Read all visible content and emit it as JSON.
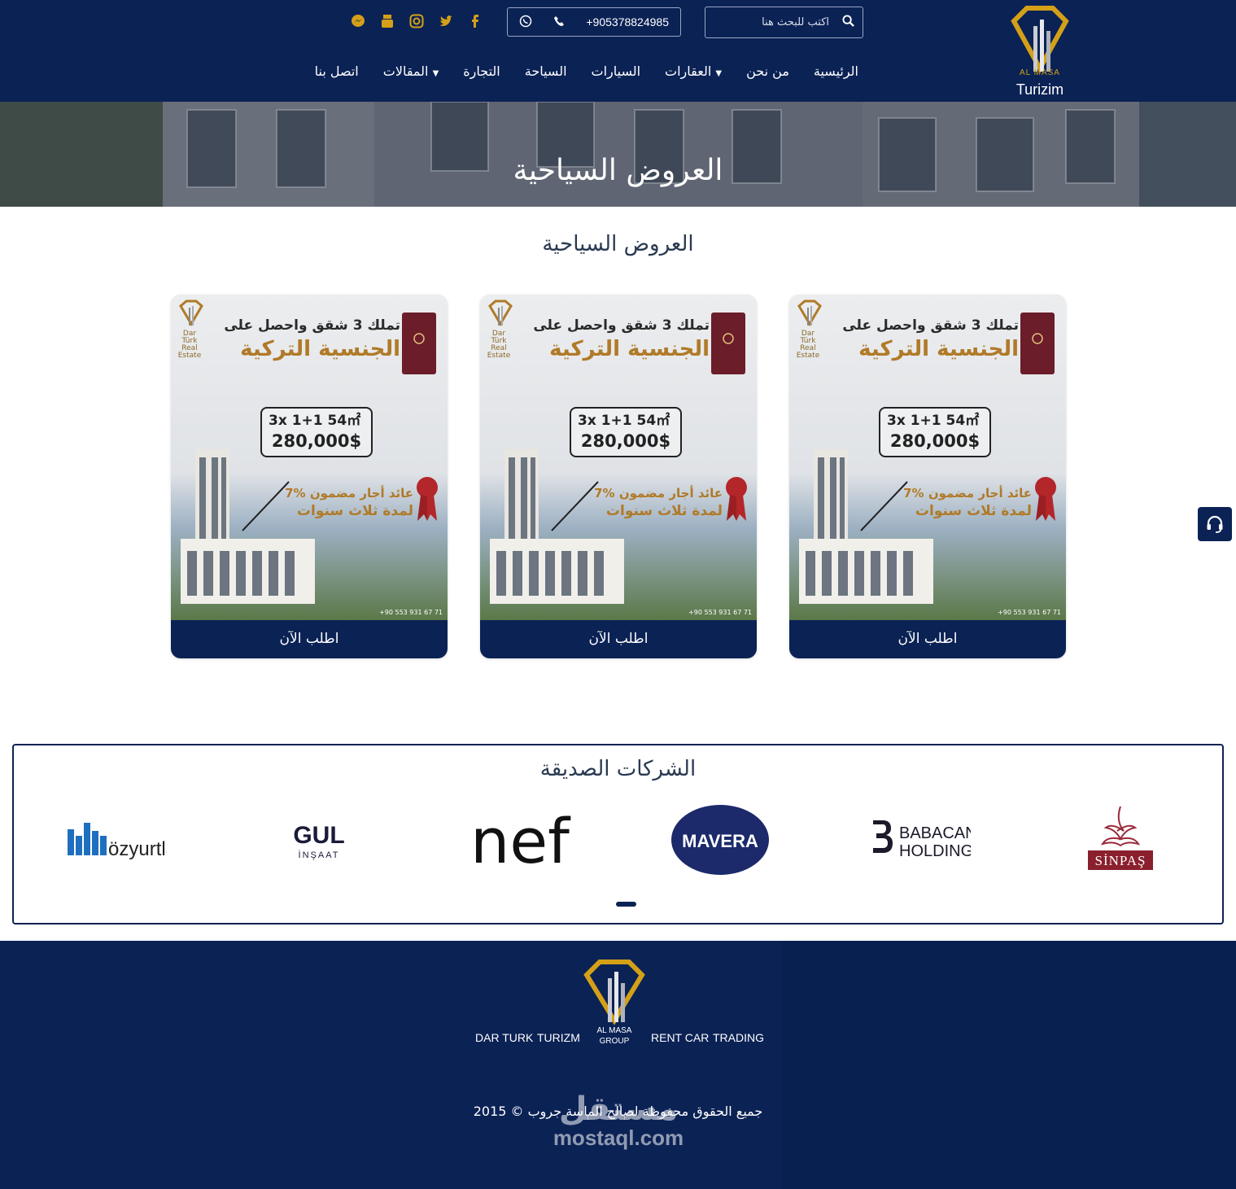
{
  "brand": {
    "logo_text": "AL MASA",
    "sub": "Turizim"
  },
  "search": {
    "placeholder": "اكتب للبحث هنا"
  },
  "contact": {
    "phone": "+905378824985"
  },
  "social": [
    "messenger-icon",
    "youtube-icon",
    "instagram-icon",
    "twitter-icon",
    "facebook-icon"
  ],
  "nav": {
    "items": [
      "الرئيسية",
      "من نحن",
      "العقارات",
      "السيارات",
      "السياحة",
      "التجارة",
      "المقالات",
      "اتصل بنا"
    ]
  },
  "hero": {
    "title": "العروض السياحية"
  },
  "section": {
    "title": "العروض السياحية"
  },
  "offer": {
    "line1": "تملك 3 شقق واحصل على",
    "line2": "الجنسية التركية",
    "brand": "Dar Türk Real Estate",
    "spec": "3x  1+1  54㎡",
    "price": "280,000$",
    "rent1": "7% عائد أجار مضمون",
    "rent2": "لمدة ثلاث سنوات",
    "contact": "+90 553 931 67 71",
    "button": "اطلب الآن"
  },
  "partners": {
    "title": "الشركات الصديقة",
    "logos": [
      "özyurtlar",
      "GUL İNŞAAT",
      "nef",
      "MAVERA",
      "BABACAN HOLDING",
      "SİNPAŞ"
    ]
  },
  "footer": {
    "group": "AL MASA GROUP",
    "links": [
      "DAR TURK",
      "TURIZM",
      "RENT CAR",
      "TRADING"
    ],
    "copyright": "جميع الحقوق محفوظة لصالح الماسة جروب © 2015",
    "watermark1": "مستقل",
    "watermark2": "mostaql.com"
  },
  "colors": {
    "navy": "#0b2255",
    "gold": "#d4a017"
  }
}
